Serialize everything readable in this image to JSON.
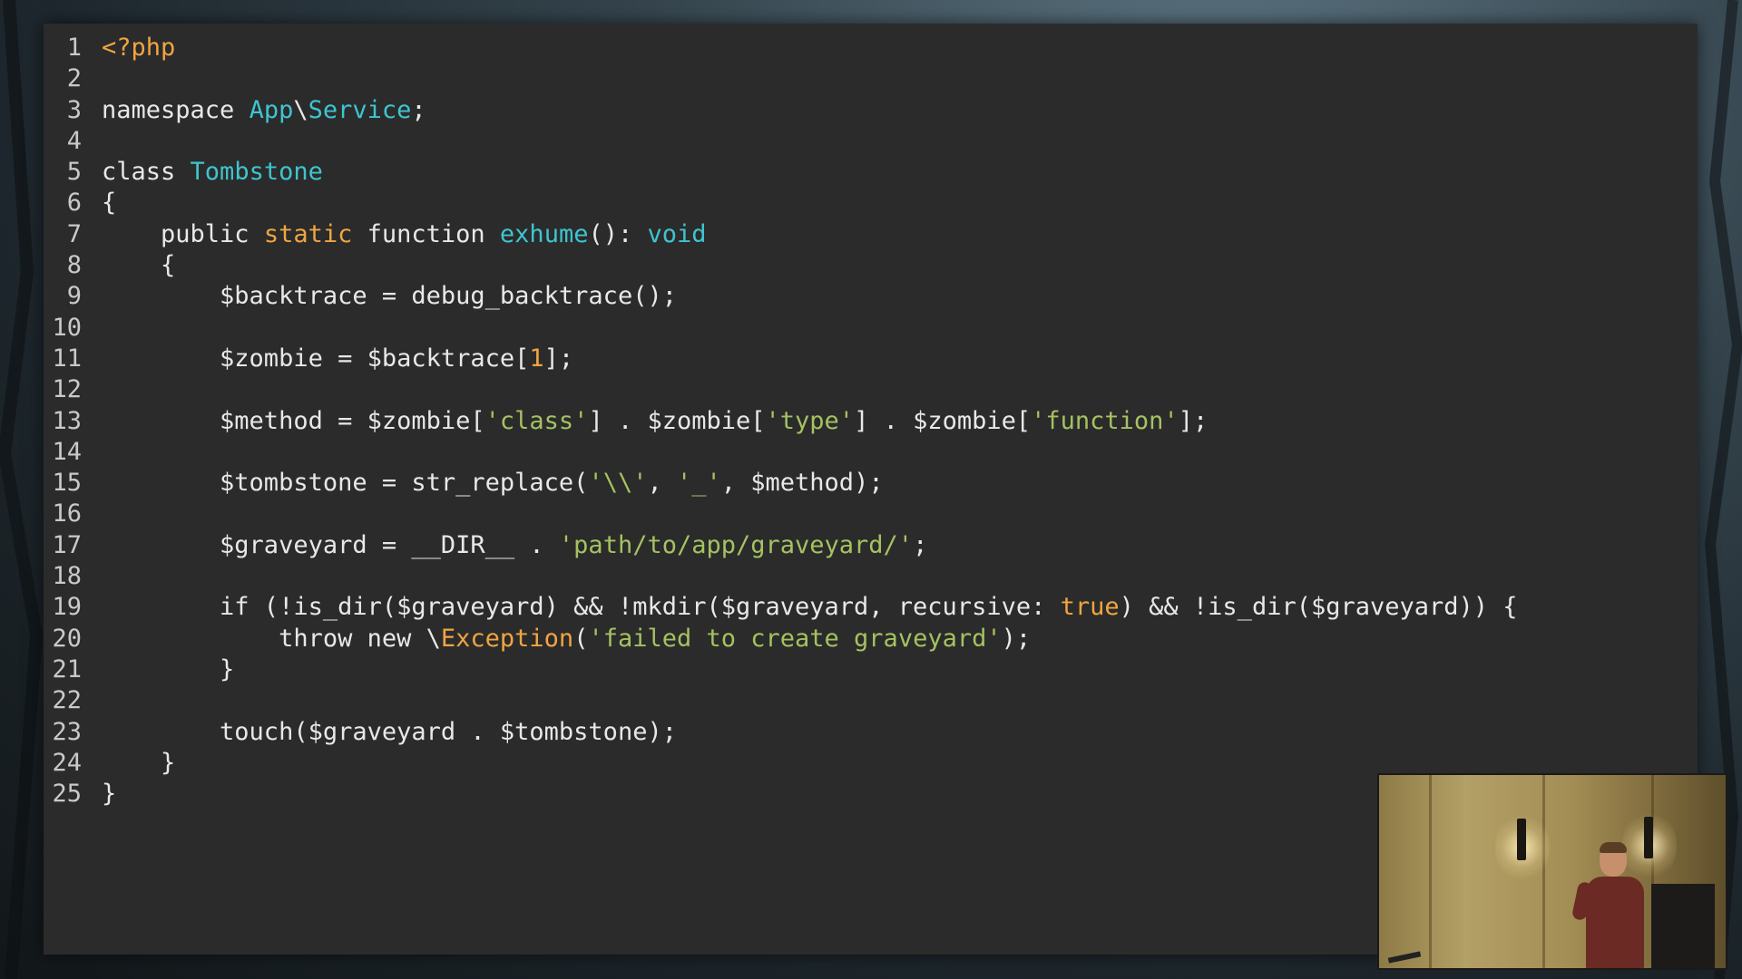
{
  "code_lines": [
    {
      "n": "1",
      "parts": [
        {
          "t": "<?php",
          "c": "k-orange"
        }
      ]
    },
    {
      "n": "2",
      "parts": []
    },
    {
      "n": "3",
      "parts": [
        {
          "t": "namespace ",
          "c": "txt"
        },
        {
          "t": "App",
          "c": "k-cyan"
        },
        {
          "t": "\\",
          "c": "txt"
        },
        {
          "t": "Service",
          "c": "k-cyan"
        },
        {
          "t": ";",
          "c": "txt"
        }
      ]
    },
    {
      "n": "4",
      "parts": []
    },
    {
      "n": "5",
      "parts": [
        {
          "t": "class ",
          "c": "txt"
        },
        {
          "t": "Tombstone",
          "c": "k-cyan"
        }
      ]
    },
    {
      "n": "6",
      "parts": [
        {
          "t": "{",
          "c": "txt"
        }
      ]
    },
    {
      "n": "7",
      "parts": [
        {
          "t": "    public ",
          "c": "txt"
        },
        {
          "t": "static",
          "c": "k-orange"
        },
        {
          "t": " function ",
          "c": "txt"
        },
        {
          "t": "exhume",
          "c": "k-cyan"
        },
        {
          "t": "(): ",
          "c": "txt"
        },
        {
          "t": "void",
          "c": "k-cyan"
        }
      ]
    },
    {
      "n": "8",
      "parts": [
        {
          "t": "    {",
          "c": "txt"
        }
      ]
    },
    {
      "n": "9",
      "parts": [
        {
          "t": "        $backtrace = debug_backtrace();",
          "c": "txt"
        }
      ]
    },
    {
      "n": "10",
      "parts": []
    },
    {
      "n": "11",
      "parts": [
        {
          "t": "        $zombie = $backtrace[",
          "c": "txt"
        },
        {
          "t": "1",
          "c": "k-num"
        },
        {
          "t": "];",
          "c": "txt"
        }
      ]
    },
    {
      "n": "12",
      "parts": []
    },
    {
      "n": "13",
      "parts": [
        {
          "t": "        $method = $zombie[",
          "c": "txt"
        },
        {
          "t": "'class'",
          "c": "k-green"
        },
        {
          "t": "] . $zombie[",
          "c": "txt"
        },
        {
          "t": "'type'",
          "c": "k-green"
        },
        {
          "t": "] . $zombie[",
          "c": "txt"
        },
        {
          "t": "'function'",
          "c": "k-green"
        },
        {
          "t": "];",
          "c": "txt"
        }
      ]
    },
    {
      "n": "14",
      "parts": []
    },
    {
      "n": "15",
      "parts": [
        {
          "t": "        $tombstone = str_replace(",
          "c": "txt"
        },
        {
          "t": "'\\\\'",
          "c": "k-green"
        },
        {
          "t": ", ",
          "c": "txt"
        },
        {
          "t": "'_'",
          "c": "k-green"
        },
        {
          "t": ", $method);",
          "c": "txt"
        }
      ]
    },
    {
      "n": "16",
      "parts": []
    },
    {
      "n": "17",
      "parts": [
        {
          "t": "        $graveyard = __DIR__ . ",
          "c": "txt"
        },
        {
          "t": "'path/to/app/graveyard/'",
          "c": "k-green"
        },
        {
          "t": ";",
          "c": "txt"
        }
      ]
    },
    {
      "n": "18",
      "parts": []
    },
    {
      "n": "19",
      "parts": [
        {
          "t": "        if (!is_dir($graveyard) && !mkdir($graveyard, recursive: ",
          "c": "txt"
        },
        {
          "t": "true",
          "c": "k-orange"
        },
        {
          "t": ") && !is_dir($graveyard)) {",
          "c": "txt"
        }
      ]
    },
    {
      "n": "20",
      "parts": [
        {
          "t": "            throw new \\",
          "c": "txt"
        },
        {
          "t": "Exception",
          "c": "k-orange"
        },
        {
          "t": "(",
          "c": "txt"
        },
        {
          "t": "'failed to create graveyard'",
          "c": "k-green"
        },
        {
          "t": ");",
          "c": "txt"
        }
      ]
    },
    {
      "n": "21",
      "parts": [
        {
          "t": "        }",
          "c": "txt"
        }
      ]
    },
    {
      "n": "22",
      "parts": []
    },
    {
      "n": "23",
      "parts": [
        {
          "t": "        touch($graveyard . $tombstone);",
          "c": "txt"
        }
      ]
    },
    {
      "n": "24",
      "parts": [
        {
          "t": "    }",
          "c": "txt"
        }
      ]
    },
    {
      "n": "25",
      "parts": [
        {
          "t": "}",
          "c": "txt"
        }
      ]
    }
  ],
  "colors": {
    "editor_bg": "#2b2b2b",
    "keyword_orange": "#f0a541",
    "identifier_cyan": "#3ec5cf",
    "string_green": "#a5c261",
    "text": "#e8e8e8"
  }
}
